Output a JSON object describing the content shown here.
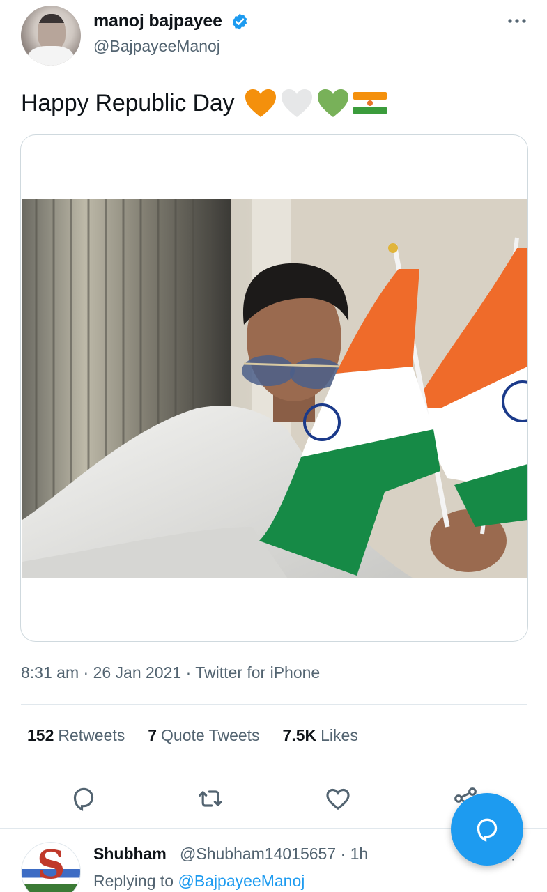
{
  "author": {
    "display_name": "manoj bajpayee",
    "handle": "@BajpayeeManoj",
    "verified": true
  },
  "tweet": {
    "text": "Happy Republic Day",
    "emojis": [
      "orange-heart",
      "white-heart",
      "green-heart",
      "flag"
    ],
    "time": "8:31 am",
    "date": "26 Jan 2021",
    "source": "Twitter for iPhone",
    "separator": "·"
  },
  "stats": {
    "retweets_count": "152",
    "retweets_label": "Retweets",
    "quote_count": "7",
    "quote_label": "Quote Tweets",
    "likes_count": "7.5K",
    "likes_label": "Likes"
  },
  "actions": [
    "reply-icon",
    "retweet-icon",
    "like-icon",
    "share-icon"
  ],
  "reply": {
    "name": "Shubham",
    "handle": "@Shubham14015657 · 1h",
    "replying_prefix": "Replying to",
    "replying_to": "@BajpayeeManoj",
    "more": "·"
  },
  "colors": {
    "accent": "#1d9bf0",
    "secondary_text": "#536471",
    "saffron": "#ff8a1e",
    "india_green": "#128a3c"
  }
}
